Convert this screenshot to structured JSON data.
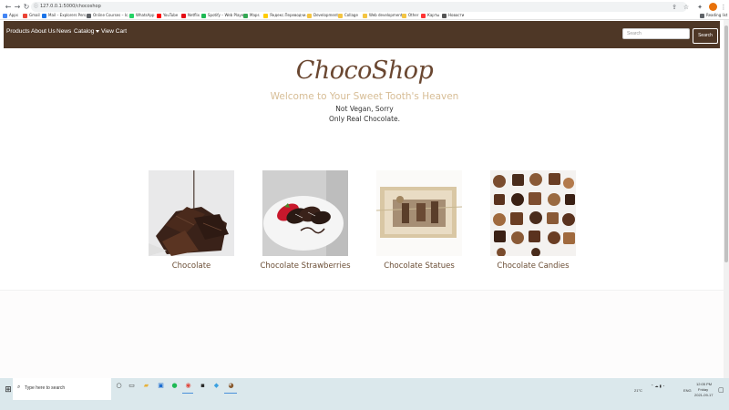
{
  "browser": {
    "url": "127.0.0.1:5000/chocoshop",
    "bookmarks": [
      {
        "label": "Apps",
        "color": "#4285f4"
      },
      {
        "label": "Gmail",
        "color": "#ea4335"
      },
      {
        "label": "Mail – Explorers Pers...",
        "color": "#1a73e8"
      },
      {
        "label": "Online Courses – Ic...",
        "color": "#5f6368"
      },
      {
        "label": "WhatsApp",
        "color": "#25d366"
      },
      {
        "label": "YouTube",
        "color": "#ff0000"
      },
      {
        "label": "Netflix",
        "color": "#e50914"
      },
      {
        "label": "Spotify – Web Player",
        "color": "#1db954"
      },
      {
        "label": "Maps",
        "color": "#34a853"
      },
      {
        "label": "Яндекс.Переводчи...",
        "color": "#ffcc00"
      },
      {
        "label": "Development",
        "color": "#f4c542"
      },
      {
        "label": "Collage",
        "color": "#f4c542"
      },
      {
        "label": "Web development",
        "color": "#f4c542"
      },
      {
        "label": "Other",
        "color": "#f4c542"
      },
      {
        "label": "Карты",
        "color": "#ff3333"
      },
      {
        "label": "Новости",
        "color": "#555555"
      }
    ],
    "reading_list": "Reading list"
  },
  "navbar": {
    "links": [
      "Products",
      "About Us",
      "News",
      "Catalog",
      "View Cart"
    ],
    "search_placeholder": "Search",
    "search_button": "Search"
  },
  "hero": {
    "logo": "ChocoShop",
    "welcome": "Welcome to Your Sweet Tooth's Heaven",
    "tagline1": "Not Vegan, Sorry",
    "tagline2": "Only Real Chocolate."
  },
  "products": [
    {
      "title": "Chocolate"
    },
    {
      "title": "Chocolate Strawberries"
    },
    {
      "title": "Chocolate Statues"
    },
    {
      "title": "Chocolate Candies"
    }
  ],
  "taskbar": {
    "search_text": "Type here to search",
    "weather": "21°C",
    "language": "ENG",
    "time": "12:05 PM",
    "day": "Friday",
    "date": "2021-09-17"
  },
  "colors": {
    "navbar_bg": "#4e3726",
    "logo": "#6a4731",
    "welcome": "#d7bd96",
    "product_title": "#6b4e36"
  }
}
